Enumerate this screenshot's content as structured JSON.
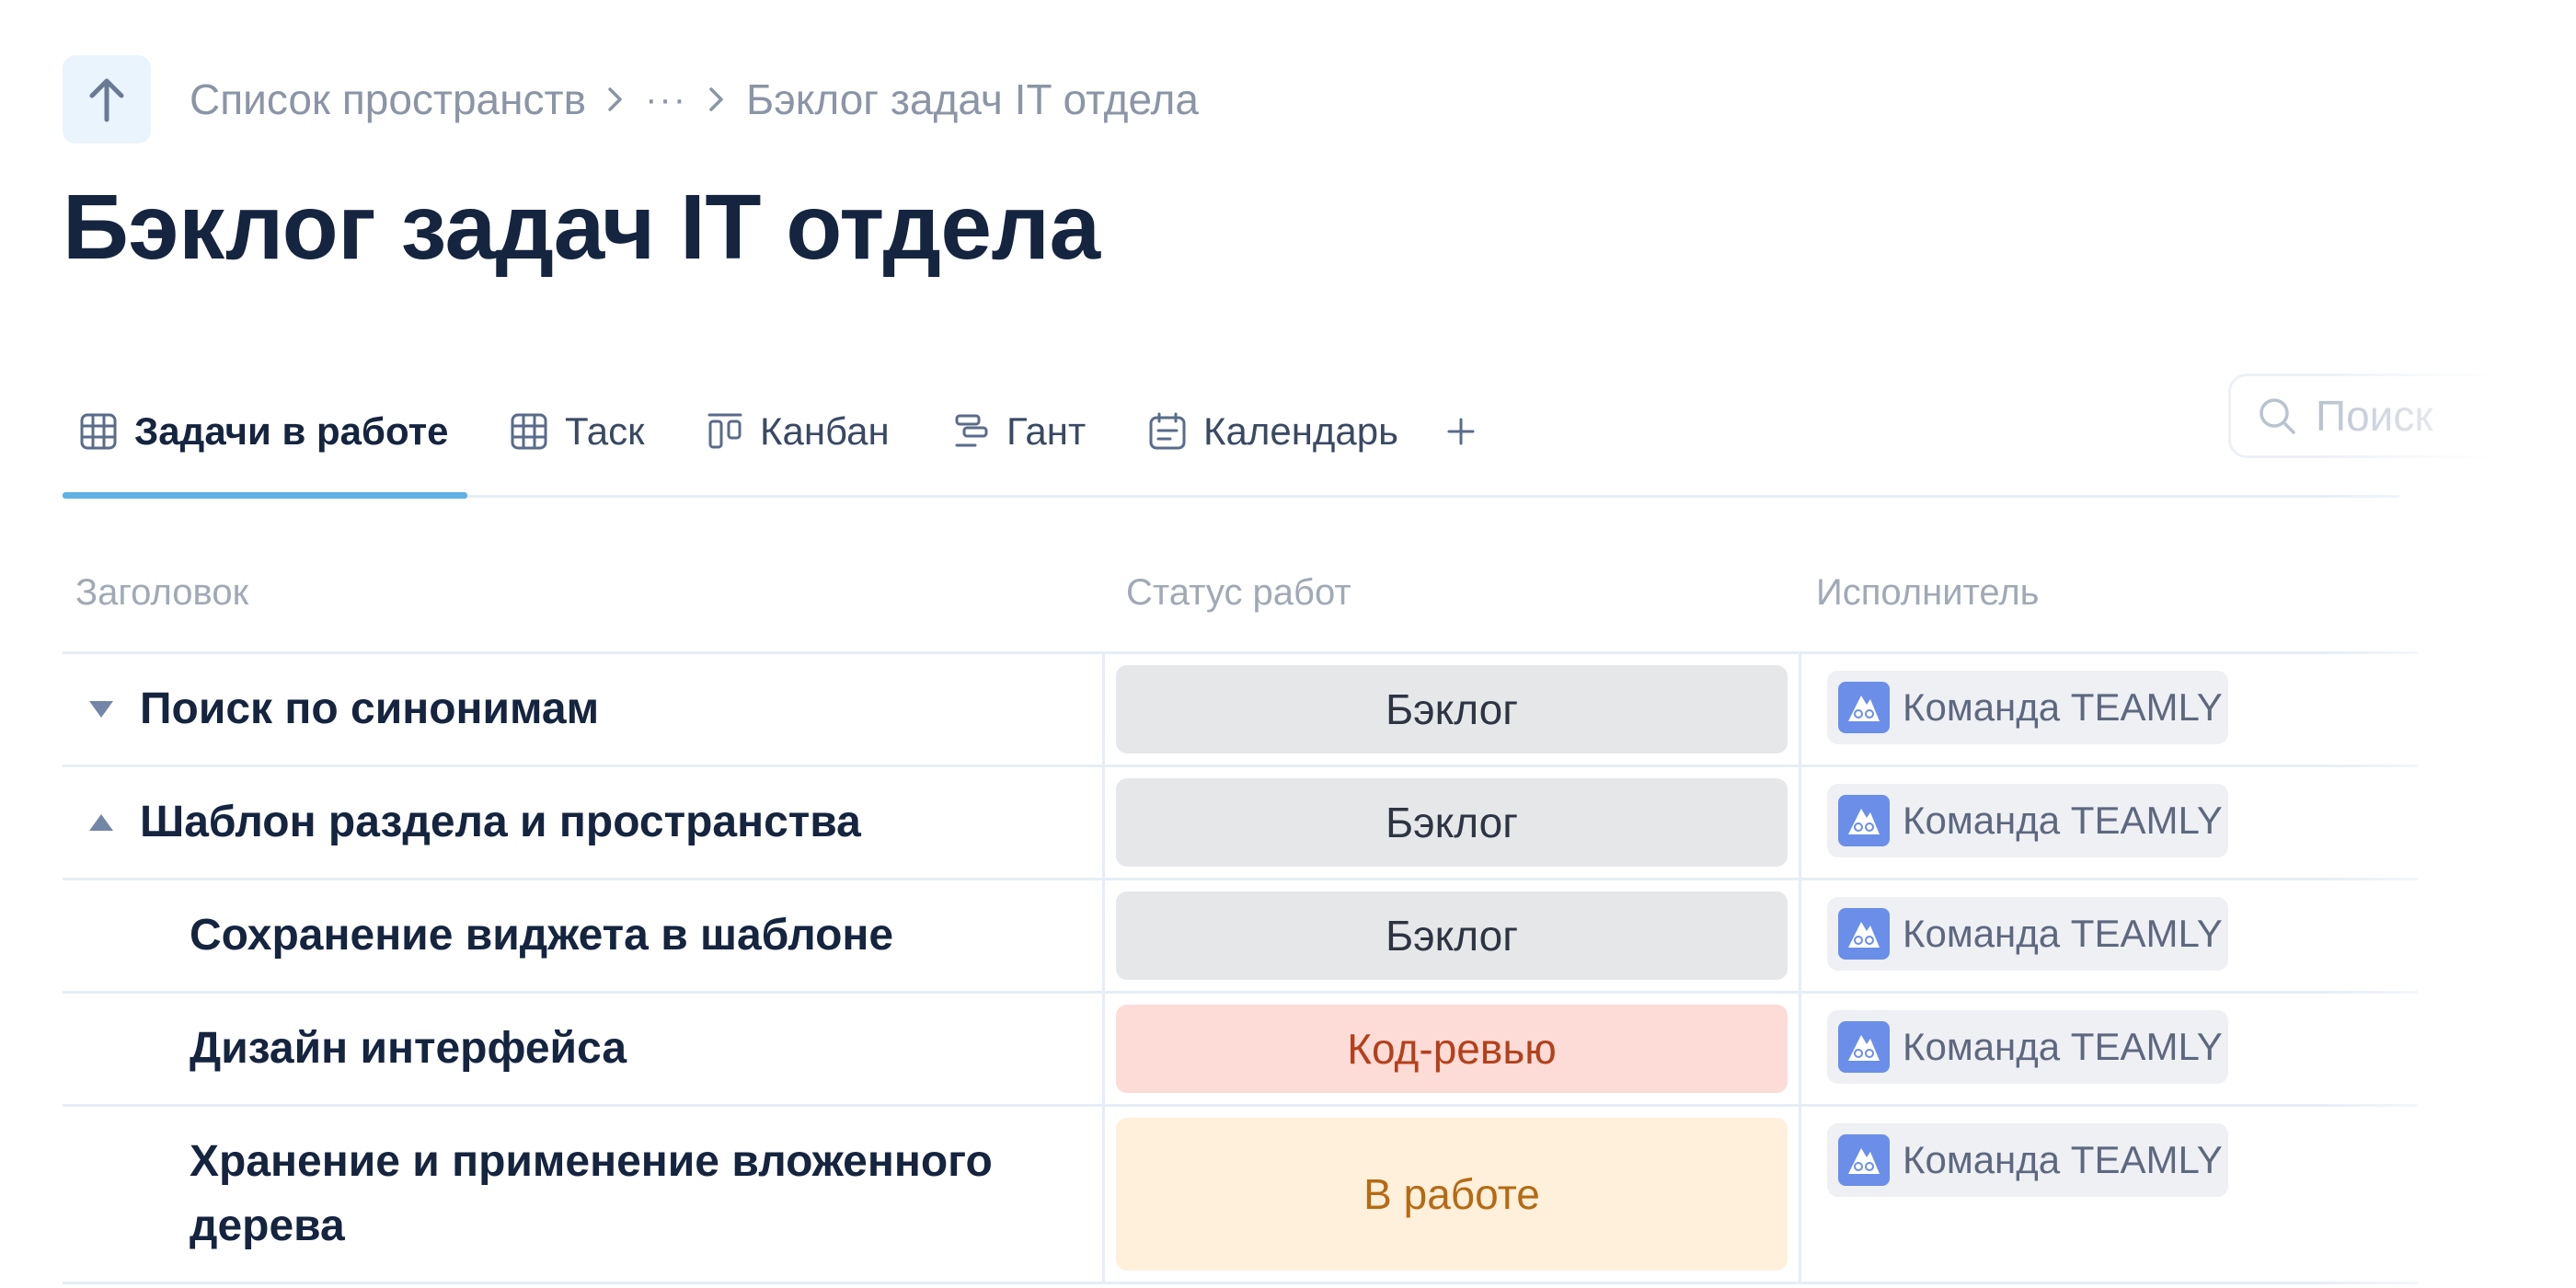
{
  "breadcrumb": {
    "root": "Список пространств",
    "ellipsis": "···",
    "current": "Бэклог задач IT отдела"
  },
  "page_title": "Бэклог задач IT отдела",
  "tabs": [
    {
      "label": "Задачи в работе",
      "icon": "table-grid-icon",
      "active": true
    },
    {
      "label": "Таск",
      "icon": "table-grid-icon",
      "active": false
    },
    {
      "label": "Канбан",
      "icon": "kanban-icon",
      "active": false
    },
    {
      "label": "Гант",
      "icon": "gantt-icon",
      "active": false
    },
    {
      "label": "Календарь",
      "icon": "calendar-icon",
      "active": false
    }
  ],
  "add_tab": "+",
  "search": {
    "placeholder": "Поиск"
  },
  "table": {
    "headers": {
      "title": "Заголовок",
      "status": "Статус работ",
      "assignee": "Исполнитель"
    },
    "rows": [
      {
        "title": "Поиск по синонимам",
        "toggle": "collapsed",
        "status": "Бэклог",
        "status_kind": "backlog",
        "assignee": "Команда TEAMLY"
      },
      {
        "title": "Шаблон раздела и пространства",
        "toggle": "expanded",
        "status": "Бэклог",
        "status_kind": "backlog",
        "assignee": "Команда TEAMLY"
      },
      {
        "title": "Сохранение виджета в шаблоне",
        "toggle": "child",
        "status": "Бэклог",
        "status_kind": "backlog",
        "assignee": "Команда TEAMLY"
      },
      {
        "title": "Дизайн интерфейса",
        "toggle": "child",
        "status": "Код-ревью",
        "status_kind": "review",
        "assignee": "Команда TEAMLY"
      },
      {
        "title": "Хранение и применение вложенного дерева",
        "toggle": "child",
        "status": "В работе",
        "status_kind": "work",
        "assignee": "Команда TEAMLY"
      }
    ]
  },
  "colors": {
    "accent": "#5fb1e6",
    "backlog_bg": "#e6e7e9",
    "review_bg": "#fddcd7",
    "review_text": "#b4401c",
    "work_bg": "#fff0dc",
    "work_text": "#b66a12"
  }
}
